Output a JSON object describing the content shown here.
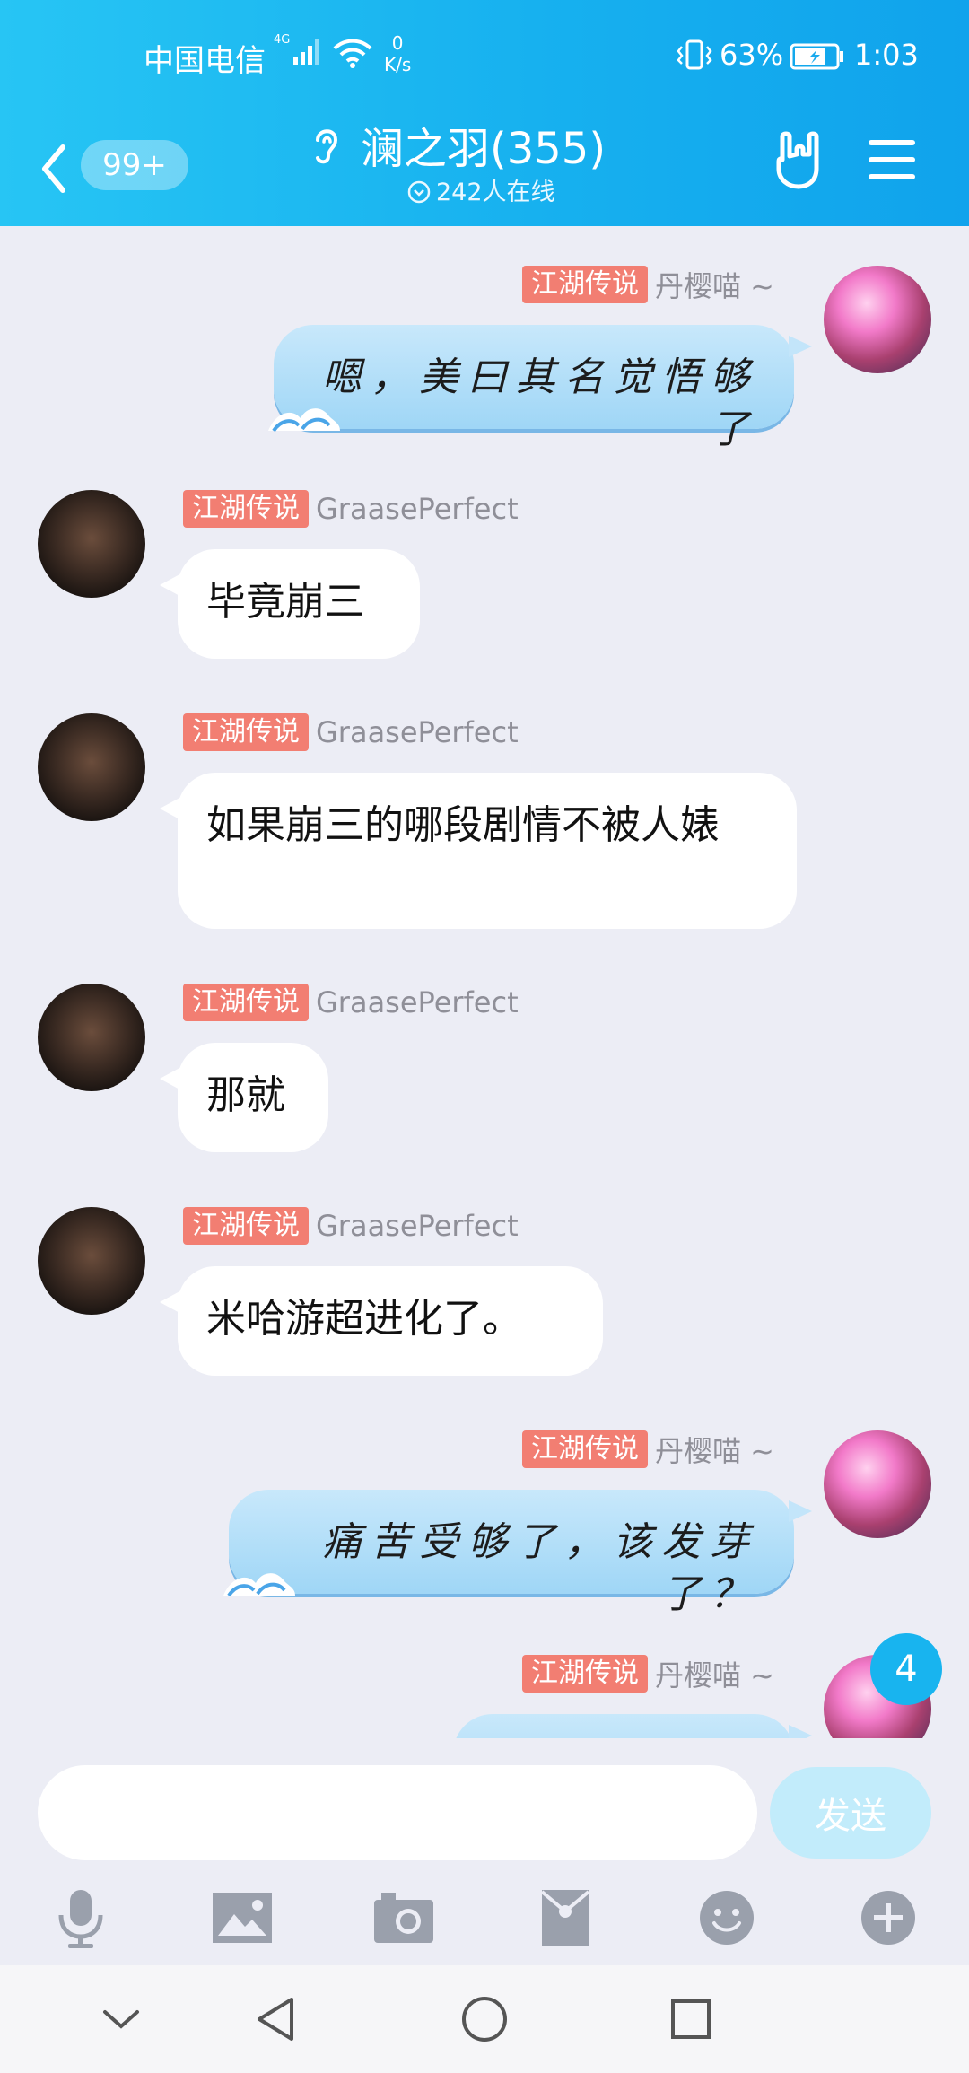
{
  "status_bar": {
    "carrier": "中国电信",
    "network": "4G",
    "speed_value": "0",
    "speed_unit": "K/s",
    "battery": "63%",
    "time": "1:03"
  },
  "header": {
    "unread_count": "99+",
    "group_title": "澜之羽(355)",
    "online": "242人在线"
  },
  "messages": [
    {
      "side": "right",
      "badge": "江湖传说",
      "sender": "丹樱喵 ~",
      "text": "嗯，美曰其名觉悟够了",
      "style": "special"
    },
    {
      "side": "left",
      "badge": "江湖传说",
      "sender": "GraasePerfect",
      "text": "毕竟崩三"
    },
    {
      "side": "left",
      "badge": "江湖传说",
      "sender": "GraasePerfect",
      "text": "如果崩三的哪段剧情不被人婊"
    },
    {
      "side": "left",
      "badge": "江湖传说",
      "sender": "GraasePerfect",
      "text": "那就"
    },
    {
      "side": "left",
      "badge": "江湖传说",
      "sender": "GraasePerfect",
      "text": "米哈游超进化了。"
    },
    {
      "side": "right",
      "badge": "江湖传说",
      "sender": "丹樱喵 ~",
      "text": "痛苦受够了，该发芽了？",
      "style": "special"
    },
    {
      "side": "right",
      "badge": "江湖传说",
      "sender": "丹樱喵 ~",
      "text": "",
      "style": "special"
    }
  ],
  "new_message_count": "4",
  "composer": {
    "input_value": "",
    "send_label": "发送"
  },
  "toolbar": [
    "microphone-icon",
    "image-icon",
    "camera-icon",
    "red-packet-icon",
    "emoji-icon",
    "plus-icon"
  ],
  "colors": {
    "header": "#17b1ef",
    "badge": "#f27e72",
    "chat_bg": "#ecedf5",
    "send_button": "#c2ecfb"
  }
}
